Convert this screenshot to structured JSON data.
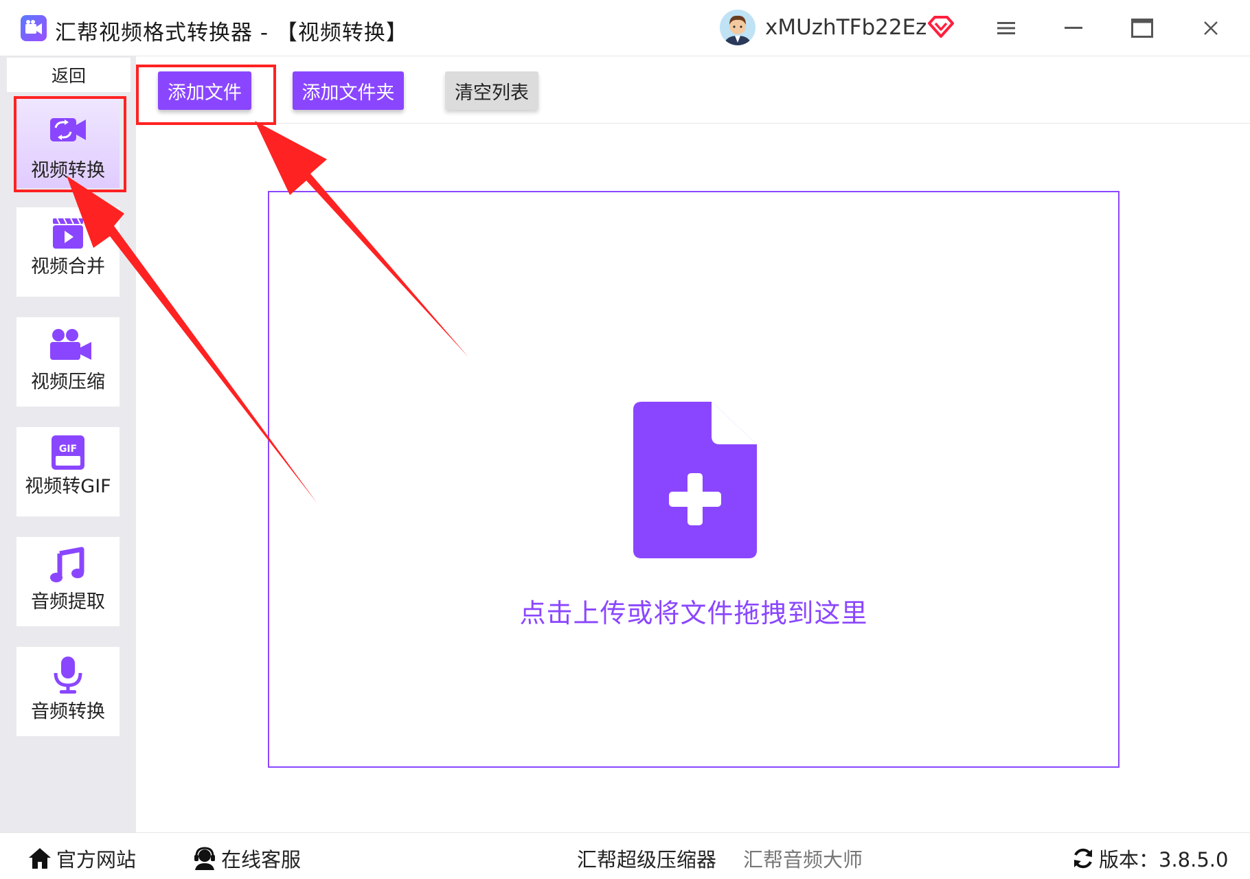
{
  "window": {
    "title": "汇帮视频格式转换器  - 【视频转换】",
    "username": "xMUzhTFb22Ez"
  },
  "sidebar": {
    "back_label": "返回",
    "items": [
      {
        "label": "视频转换",
        "icon": "video-convert-icon",
        "active": true
      },
      {
        "label": "视频合并",
        "icon": "video-merge-icon",
        "active": false
      },
      {
        "label": "视频压缩",
        "icon": "video-compress-icon",
        "active": false
      },
      {
        "label": "视频转GIF",
        "icon": "gif-icon",
        "active": false
      },
      {
        "label": "音频提取",
        "icon": "music-note-icon",
        "active": false
      },
      {
        "label": "音频转换",
        "icon": "microphone-icon",
        "active": false
      }
    ]
  },
  "toolbar": {
    "add_file": "添加文件",
    "add_folder": "添加文件夹",
    "clear_list": "清空列表"
  },
  "dropzone": {
    "hint": "点击上传或将文件拖拽到这里",
    "icon": "file-add-icon"
  },
  "footer": {
    "website": "官方网站",
    "support": "在线客服",
    "compressor": "汇帮超级压缩器",
    "audio_master": "汇帮音频大师",
    "version_label": "版本：3.8.5.0"
  },
  "colors": {
    "accent": "#8a46ff",
    "annotation": "#ff2222",
    "sidebar_bg": "#eaeaee"
  }
}
